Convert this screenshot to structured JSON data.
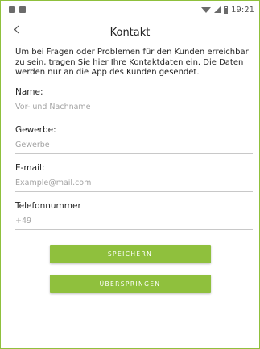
{
  "status_bar": {
    "time": "19:21"
  },
  "header": {
    "back_icon": "chevron-left-icon",
    "title": "Kontakt"
  },
  "intro_text": "Um bei Fragen oder Problemen für den Kunden erreichbar zu sein, tragen Sie hier Ihre Kontaktdaten ein. Die Daten werden nur an die App des Kunden gesendet.",
  "fields": {
    "name": {
      "label": "Name:",
      "placeholder": "Vor- und Nachname"
    },
    "gewerbe": {
      "label": "Gewerbe:",
      "placeholder": "Gewerbe"
    },
    "email": {
      "label": "E-mail:",
      "placeholder": "Example@mail.com"
    },
    "phone": {
      "label": "Telefonnummer",
      "placeholder": "+49"
    }
  },
  "buttons": {
    "save": "SPEICHERN",
    "skip": "ÜBERSPRINGEN"
  },
  "colors": {
    "accent": "#8fc03d"
  }
}
